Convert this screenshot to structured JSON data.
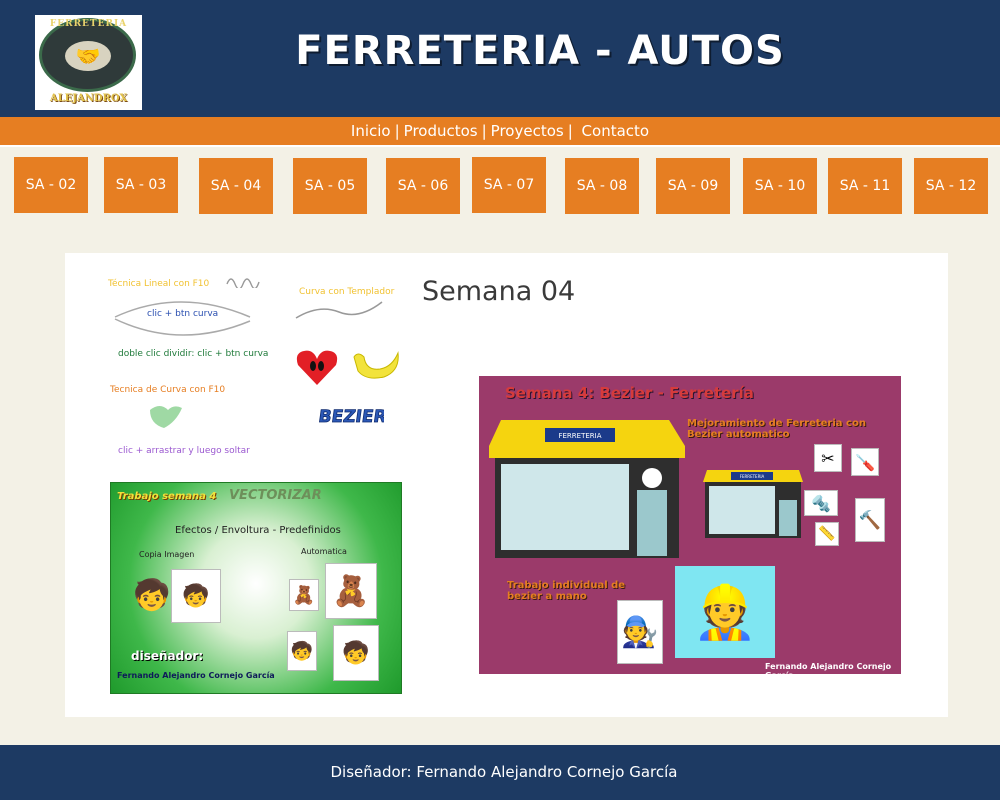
{
  "header": {
    "title": "FERRETERIA - AUTOS",
    "logo": {
      "top_text": "FERRETERIA",
      "bottom_text": "ALEJANDROX",
      "icon": "handshake-icon"
    }
  },
  "nav": {
    "links": [
      "Inicio",
      "Productos",
      "Proyectos",
      "Contacto"
    ]
  },
  "weeks": [
    "SA - 02",
    "SA - 03",
    "SA - 04",
    "SA - 05",
    "SA - 06",
    "SA - 07",
    "SA - 08",
    "SA - 09",
    "SA - 10",
    "SA - 11",
    "SA - 12"
  ],
  "main": {
    "title": "Semana 04",
    "sketch": {
      "linear_label": "Técnica Lineal con F10",
      "linear_hint": "clic + btn curva",
      "split_hint": "doble clic dividir: clic + btn curva",
      "template_label": "Curva con Templador",
      "curve_label": "Tecnica de Curva con F10",
      "drag_hint": "clic + arrastrar y luego soltar",
      "bezier_word": "BEZIER"
    },
    "green_panel": {
      "title": "Trabajo semana 4",
      "vectorizar": "VECTORIZAR",
      "subtitle": "Efectos / Envoltura - Predefinidos",
      "copy_label": "Copia Imagen",
      "auto_label": "Automatica",
      "designer_label": "diseñador:",
      "designer_name": "Fernando Alejandro Cornejo García"
    },
    "purple_panel": {
      "title": "Semana 4: Bezier - Ferretería",
      "store_sign": "FERRETERIA",
      "improvement": "Mejoramiento de Ferreteria con Bezier automatico",
      "mini_sign": "FERRETERIA",
      "individual": "Trabajo individual de bezier a mano",
      "author": "Fernando Alejandro Cornejo García"
    }
  },
  "footer": {
    "text": "Diseñador: Fernando Alejandro Cornejo García"
  },
  "colors": {
    "header_bg": "#1d3a63",
    "accent": "#e67e22",
    "page_bg": "#f3f1e6"
  }
}
